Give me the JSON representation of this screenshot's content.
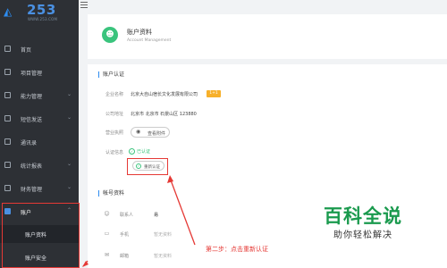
{
  "brand": {
    "logo_number": "253",
    "logo_sub": "WWW.253.COM"
  },
  "sidebar": {
    "items": [
      {
        "label": "首页",
        "has_arrow": false
      },
      {
        "label": "项目管理",
        "has_arrow": false
      },
      {
        "label": "能力管理",
        "has_arrow": true
      },
      {
        "label": "短信发送",
        "has_arrow": true
      },
      {
        "label": "通讯录",
        "has_arrow": false
      },
      {
        "label": "统计报表",
        "has_arrow": true
      },
      {
        "label": "财务管理",
        "has_arrow": true
      },
      {
        "label": "账户",
        "has_arrow": true
      }
    ],
    "sub_items": [
      {
        "label": "账户资料"
      },
      {
        "label": "账户安全"
      }
    ],
    "chevron": "⌄",
    "chevron_up": "⌃"
  },
  "header": {
    "title": "账户资料",
    "subtitle": "Account Management"
  },
  "auth_section": {
    "title": "账户认证",
    "company_label": "企业名称",
    "company_value": "北京大自山宿长文化发展有限公司",
    "vip_tag": "1+1",
    "address_label": "公司地址",
    "address_value": "北京市 北京市 石景山区 123880",
    "license_label": "营业执照",
    "view_button": "查看附件",
    "status_label": "认证信息",
    "status_value": "已认证",
    "reauth_button": "重新认证"
  },
  "account_section": {
    "title": "帐号资料",
    "rows": [
      {
        "icon": "user-icon",
        "label": "联系人",
        "value": "易"
      },
      {
        "icon": "phone-icon",
        "label": "手机",
        "value": "暂无资料"
      },
      {
        "icon": "mail-icon",
        "label": "邮箱",
        "value": "暂无资料"
      }
    ]
  },
  "annotation": {
    "text": "第二步：点击重新认证"
  },
  "watermark": {
    "main": "百科全说",
    "sub": "助你轻松解决"
  },
  "colors": {
    "sidebar_bg": "#2d3035",
    "accent": "#2d8cf0",
    "success": "#3ac47d",
    "annotation": "#e53935",
    "watermark": "#1a9a4e"
  }
}
